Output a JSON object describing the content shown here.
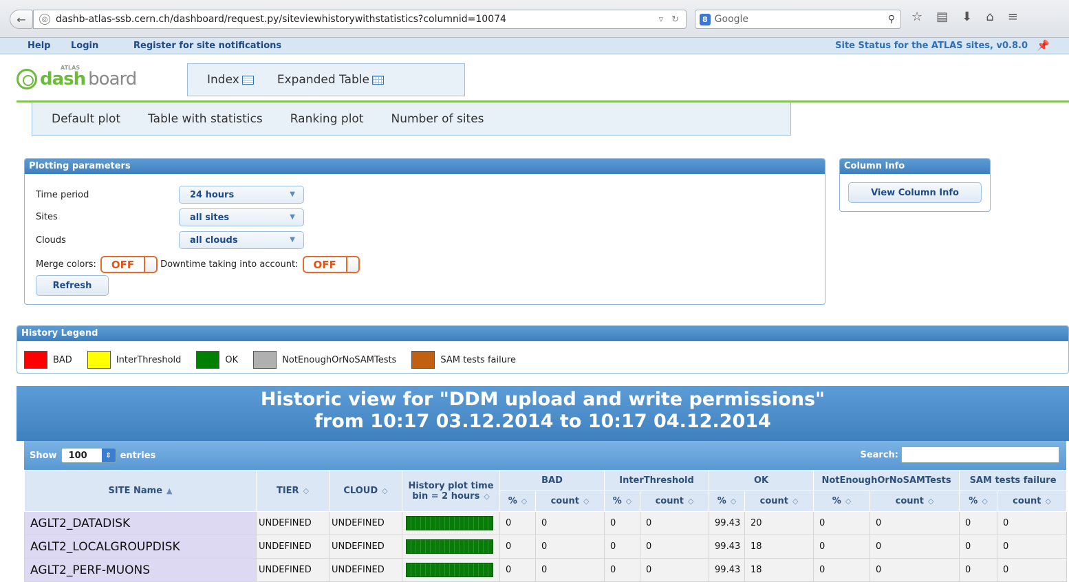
{
  "browser": {
    "url": "dashb-atlas-ssb.cern.ch/dashboard/request.py/siteviewhistorywithstatistics?columnid=10074",
    "search_engine": "8",
    "search_placeholder": "Google"
  },
  "top_links": {
    "help": "Help",
    "login": "Login",
    "register": "Register for site notifications",
    "status": "Site Status for the ATLAS sites, v0.8.0"
  },
  "logo": {
    "small": "ATLAS",
    "dash": "dash",
    "board": "board"
  },
  "main_tabs": [
    "Index",
    "Expanded Table"
  ],
  "sub_tabs": [
    "Default plot",
    "Table with statistics",
    "Ranking plot",
    "Number of sites"
  ],
  "plotting": {
    "title": "Plotting parameters",
    "time_label": "Time period",
    "time_value": "24 hours",
    "sites_label": "Sites",
    "sites_value": "all sites",
    "clouds_label": "Clouds",
    "clouds_value": "all clouds",
    "merge_label": "Merge colors:",
    "merge_value": "OFF",
    "downtime_label": "Downtime taking into account:",
    "downtime_value": "OFF",
    "refresh": "Refresh"
  },
  "column_info": {
    "title": "Column Info",
    "button": "View Column Info"
  },
  "legend": {
    "title": "History Legend",
    "items": [
      {
        "label": "BAD",
        "color": "#ff0000"
      },
      {
        "label": "InterThreshold",
        "color": "#ffff00"
      },
      {
        "label": "OK",
        "color": "#008000"
      },
      {
        "label": "NotEnoughOrNoSAMTests",
        "color": "#b0b0b0"
      },
      {
        "label": "SAM tests failure",
        "color": "#c06010"
      }
    ]
  },
  "historic": {
    "line1": "Historic view for \"DDM upload and write permissions\"",
    "line2": "from 10:17 03.12.2014 to 10:17 04.12.2014"
  },
  "table": {
    "show": "Show",
    "entries_value": "100",
    "entries": "entries",
    "search": "Search:",
    "headers": {
      "site": "SITE Name",
      "tier": "TIER",
      "cloud": "CLOUD",
      "history": "History plot time bin = 2 hours",
      "bad": "BAD",
      "inter": "InterThreshold",
      "ok": "OK",
      "not_enough": "NotEnoughOrNoSAMTests",
      "sam": "SAM tests failure",
      "pct": "%",
      "count": "count"
    },
    "rows": [
      {
        "site": "AGLT2_DATADISK",
        "tier": "UNDEFINED",
        "cloud": "UNDEFINED",
        "v": [
          "0",
          "0",
          "0",
          "0",
          "99.43",
          "20",
          "0",
          "0",
          "0",
          "0"
        ]
      },
      {
        "site": "AGLT2_LOCALGROUPDISK",
        "tier": "UNDEFINED",
        "cloud": "UNDEFINED",
        "v": [
          "0",
          "0",
          "0",
          "0",
          "99.43",
          "18",
          "0",
          "0",
          "0",
          "0"
        ]
      },
      {
        "site": "AGLT2_PERF-MUONS",
        "tier": "UNDEFINED",
        "cloud": "UNDEFINED",
        "v": [
          "0",
          "0",
          "0",
          "0",
          "99.43",
          "18",
          "0",
          "0",
          "0",
          "0"
        ]
      }
    ]
  }
}
